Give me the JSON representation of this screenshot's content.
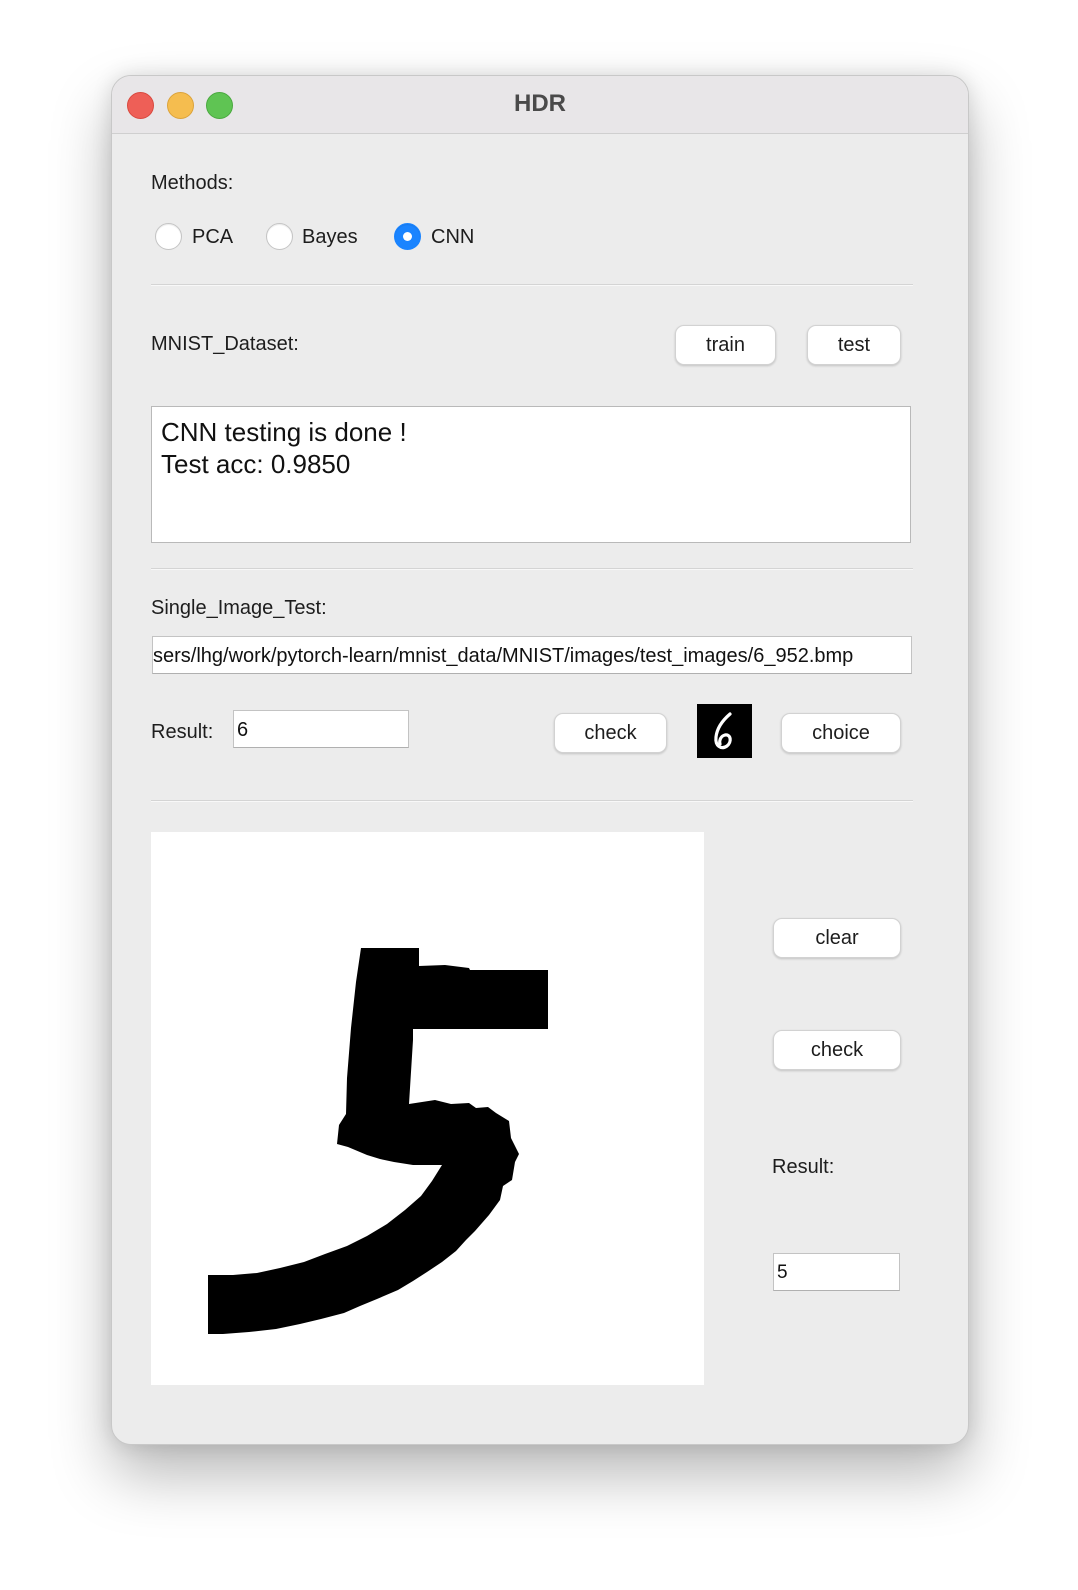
{
  "window": {
    "title": "HDR"
  },
  "methods": {
    "label": "Methods:",
    "options": [
      {
        "label": "PCA",
        "checked": false
      },
      {
        "label": "Bayes",
        "checked": false
      },
      {
        "label": "CNN",
        "checked": true
      }
    ],
    "accent_color": "#1a84ff"
  },
  "dataset": {
    "label": "MNIST_Dataset:",
    "train_label": "train",
    "test_label": "test",
    "output_text": "CNN testing is done !\nTest acc: 0.9850"
  },
  "single_image": {
    "label": "Single_Image_Test:",
    "path_value": "sers/lhg/work/pytorch-learn/mnist_data/MNIST/images/test_images/6_952.bmp",
    "result_label": "Result:",
    "result_value": "6",
    "check_label": "check",
    "choice_label": "choice",
    "thumbnail_digit": "6"
  },
  "drawing": {
    "clear_label": "clear",
    "check_label": "check",
    "result_label": "Result:",
    "result_value": "5",
    "drawn_digit": "5"
  }
}
